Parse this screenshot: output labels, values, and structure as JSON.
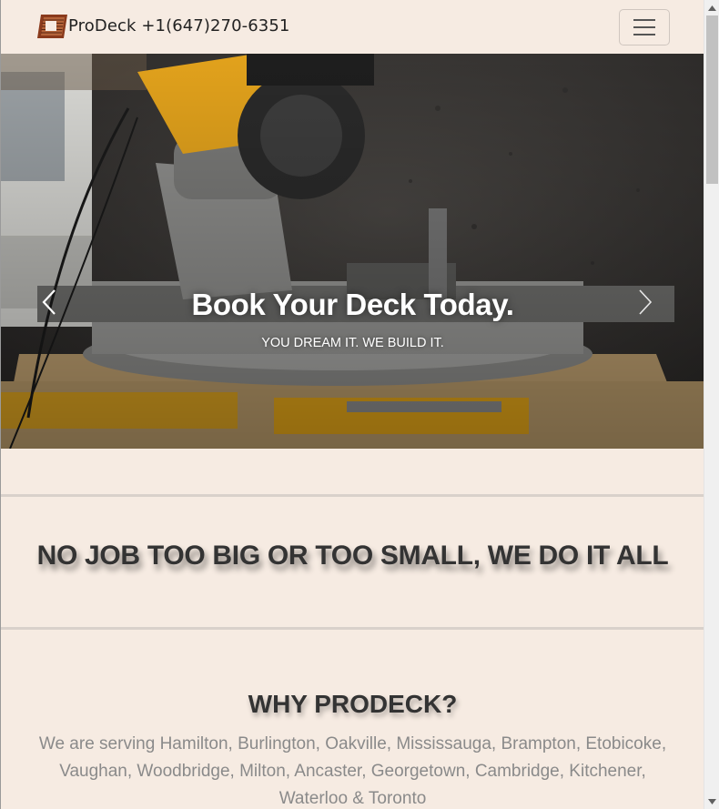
{
  "navbar": {
    "brand_text": "ProDeck +1(647)270-6351",
    "menu_toggle": "hamburger-menu-icon"
  },
  "hero": {
    "title": "Book Your Deck Today.",
    "subtitle": "YOU DREAM IT. WE BUILD IT.",
    "prev_icon": "chevron-left-icon",
    "next_icon": "chevron-right-icon"
  },
  "tagline": "NO JOB TOO BIG OR TOO SMALL, WE DO IT ALL",
  "why": {
    "title": "WHY PRODECK?",
    "text": "We are serving Hamilton, Burlington, Oakville, Mississauga, Brampton, Etobicoke, Vaughan, Woodbridge, Milton, Ancaster, Georgetown, Cambridge, Kitchener, Waterloo & Toronto"
  },
  "colors": {
    "background": "#f6ebe2",
    "divider": "#d9d1cb",
    "heading": "#333333",
    "body_text": "#8a8a8a"
  }
}
